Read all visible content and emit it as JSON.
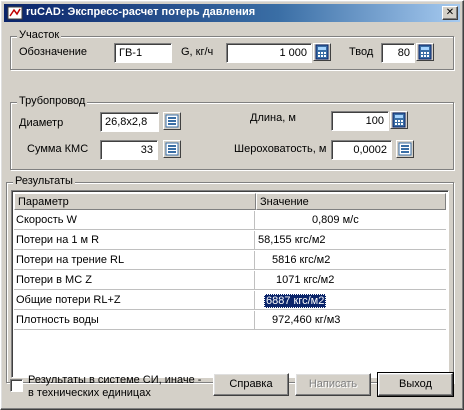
{
  "window": {
    "title": "ruCAD: Экспресс-расчет потерь давления",
    "close_glyph": "✕"
  },
  "uchastok": {
    "group_title": "Участок",
    "oboznachenie_label": "Обозначение",
    "oboznachenie_value": "ГВ-1",
    "g_label": "G, кг/ч",
    "g_value": "1 000",
    "tvod_label": "Твод",
    "tvod_value": "80"
  },
  "truboprovod": {
    "group_title": "Трубопровод",
    "diametr_label": "Диаметр",
    "diametr_value": "26,8х2,8",
    "dlina_label": "Длина, м",
    "dlina_value": "100",
    "summa_kms_label": "Сумма КМС",
    "summa_kms_value": "33",
    "sherokhovatost_label": "Шероховатость, м",
    "sherokhovatost_value": "0,0002"
  },
  "results": {
    "group_title": "Результаты",
    "columns": [
      "Параметр",
      "Значение"
    ],
    "rows": [
      {
        "param": "Скорость W",
        "value": "0,809 м/с"
      },
      {
        "param": "Потери на 1 м R",
        "value": "58,155 кгс/м2"
      },
      {
        "param": "Потери на трение RL",
        "value": "5816 кгс/м2"
      },
      {
        "param": "Потери в МС Z",
        "value": "1071 кгс/м2"
      },
      {
        "param": "Общие потери RL+Z",
        "value": "6887 кгс/м2"
      },
      {
        "param": "Плотность воды",
        "value": "972,460 кг/м3"
      }
    ]
  },
  "footer": {
    "si_checkbox_label": "Результаты в системе СИ, иначе - в технических единицах",
    "si_checked": false,
    "help_button": "Справка",
    "write_button": "Написать",
    "exit_button": "Выход"
  },
  "colors": {
    "titlebar": "#0a246a",
    "face": "#d4d0c8",
    "selection": "#0a246a"
  },
  "icons": {
    "calc": "calculator-icon",
    "list": "list-icon",
    "app": "rucad-app-icon"
  }
}
